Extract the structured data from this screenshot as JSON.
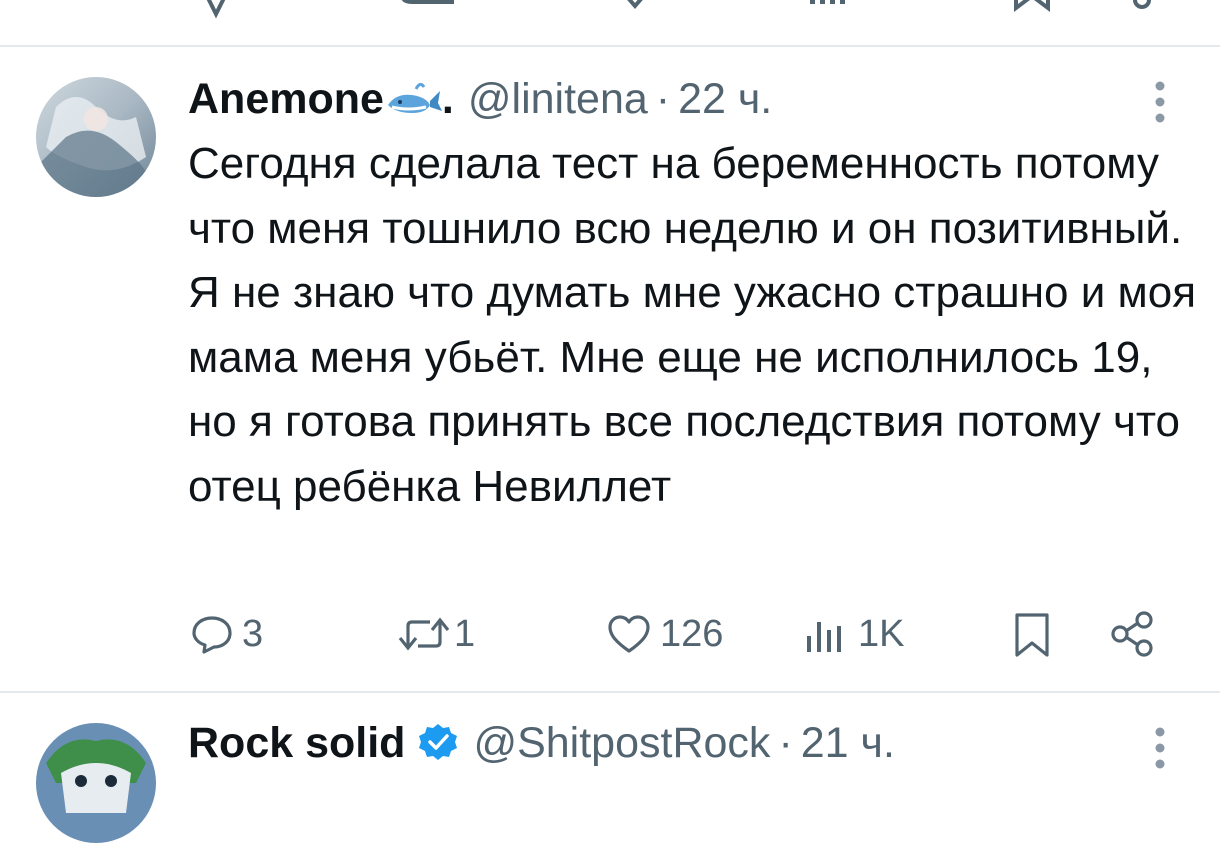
{
  "tweet": {
    "display_name": "Anemone",
    "handle": "@linitena",
    "dot": "·",
    "time": "22 ч.",
    "text": "Сегодня сделала тест на беременность потому что меня тошнило всю неделю и он позитивный. Я не знаю что думать мне ужасно страшно и моя мама меня убьёт. Мне еще не исполнилось 19, но я готова принять все последствия потому что отец ребёнка Невиллет",
    "icons": [
      "whale-emoji",
      "more-vertical-icon"
    ],
    "actions": {
      "replies": "3",
      "retweets": "1",
      "likes": "126",
      "views": "1K"
    }
  },
  "next_tweet": {
    "display_name": "Rock solid",
    "handle": "@ShitpostRock",
    "dot": "·",
    "time": "21 ч.",
    "verified_color": "#1d9bf0"
  },
  "colors": {
    "text": "#0f1419",
    "secondary": "#536471",
    "divider": "#e6e9ec"
  }
}
